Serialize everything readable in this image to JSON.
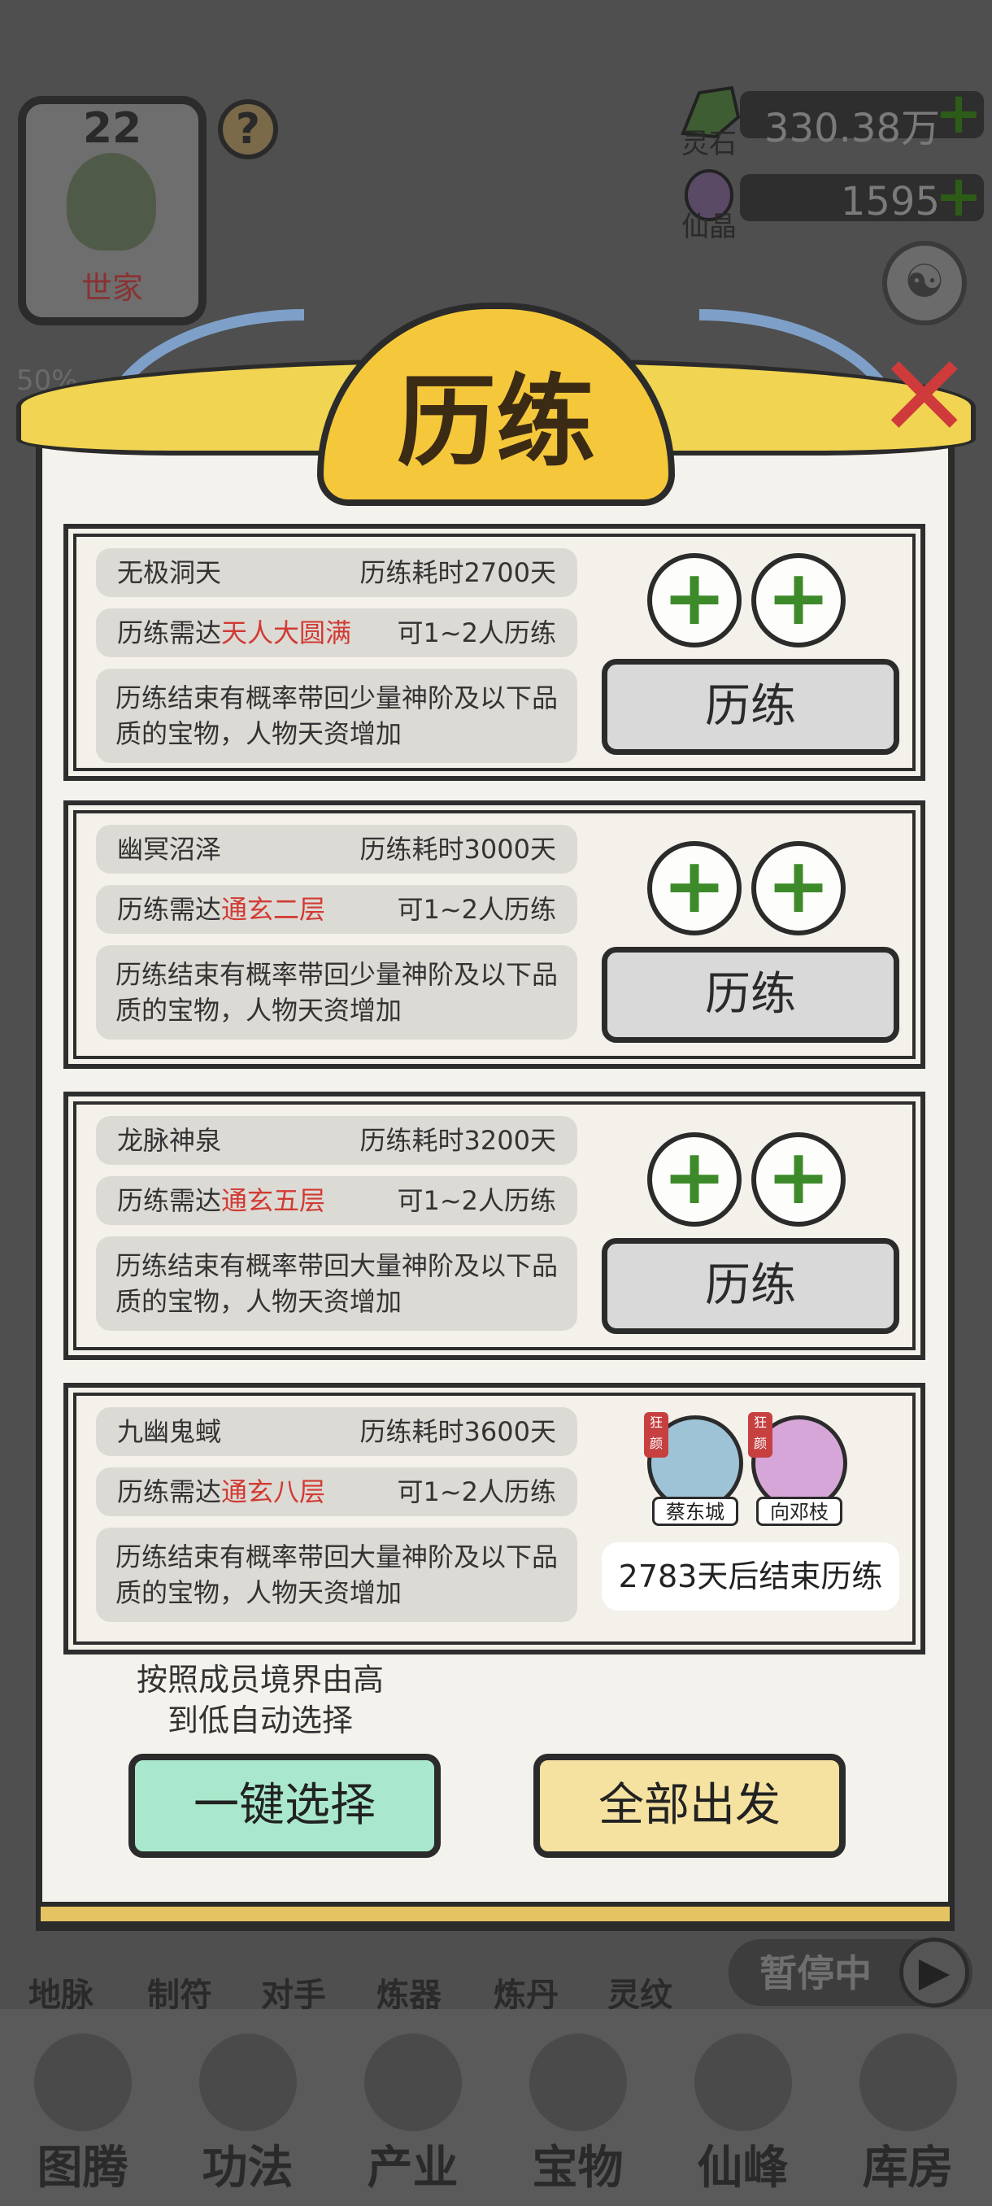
{
  "hud": {
    "level": "22",
    "clan_tag": "世家",
    "help": "?",
    "percent": "50%",
    "spirit_stone_label": "灵石",
    "spirit_stone_value": "330.38万",
    "crystal_label": "仙晶",
    "crystal_value": "1595",
    "plus": "+"
  },
  "modal": {
    "title": "历练",
    "close": "✕",
    "expeditions": [
      {
        "name": "无极洞天",
        "duration": "历练耗时2700天",
        "req_prefix": "历练需达",
        "req_realm": "天人大圆满",
        "capacity": "可1~2人历练",
        "desc": "历练结束有概率带回少量神阶及以下品质的宝物，人物天资增加",
        "button": "历练"
      },
      {
        "name": "幽冥沼泽",
        "duration": "历练耗时3000天",
        "req_prefix": "历练需达",
        "req_realm": "通玄二层",
        "capacity": "可1~2人历练",
        "desc": "历练结束有概率带回少量神阶及以下品质的宝物，人物天资增加",
        "button": "历练"
      },
      {
        "name": "龙脉神泉",
        "duration": "历练耗时3200天",
        "req_prefix": "历练需达",
        "req_realm": "通玄五层",
        "capacity": "可1~2人历练",
        "desc": "历练结束有概率带回大量神阶及以下品质的宝物，人物天资增加",
        "button": "历练"
      },
      {
        "name": "九幽鬼蜮",
        "duration": "历练耗时3600天",
        "req_prefix": "历练需达",
        "req_realm": "通玄八层",
        "capacity": "可1~2人历练",
        "desc": "历练结束有概率带回大量神阶及以下品质的宝物，人物天资增加",
        "members": [
          {
            "name": "蔡东城",
            "badge": "狂颜"
          },
          {
            "name": "向邓枝",
            "badge": "狂颜"
          }
        ],
        "eta": "2783天后结束历练"
      }
    ],
    "hint": "按照成员境界由高到低自动选择",
    "auto_select": "一键选择",
    "depart_all": "全部出发"
  },
  "sub_nav": [
    "地脉",
    "制符",
    "对手",
    "炼器",
    "炼丹",
    "灵纹"
  ],
  "pause": {
    "label": "暂停中",
    "icon": "▶"
  },
  "main_nav": [
    "图腾",
    "功法",
    "产业",
    "宝物",
    "仙峰",
    "库房"
  ],
  "colors": {
    "highlight_red": "#d23a34",
    "plus_green": "#3d8a2a",
    "banner_gold": "#f5c83c",
    "auto_btn": "#a9e8cc",
    "depart_btn": "#f6e2a0",
    "close_red": "#cf3b3b"
  }
}
